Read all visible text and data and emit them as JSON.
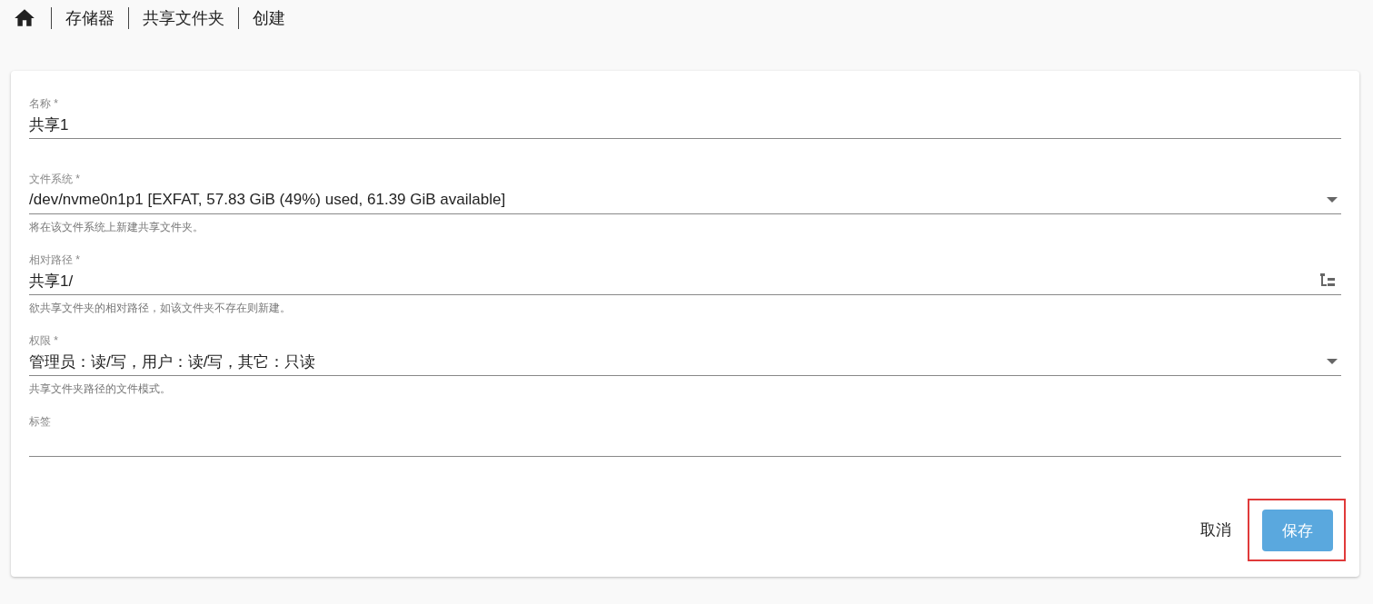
{
  "breadcrumb": [
    {
      "label": "存储器"
    },
    {
      "label": "共享文件夹"
    },
    {
      "label": "创建"
    }
  ],
  "fields": [
    {
      "kind": "text",
      "label": "名称 *",
      "value": "共享1"
    },
    {
      "kind": "select",
      "label": "文件系统 *",
      "value": "/dev/nvme0n1p1 [EXFAT, 57.83 GiB (49%) used, 61.39 GiB available]",
      "hint": "将在该文件系统上新建共享文件夹。"
    },
    {
      "kind": "folder",
      "label": "相对路径 *",
      "value": "共享1/",
      "hint": "欲共享文件夹的相对路径，如该文件夹不存在则新建。"
    },
    {
      "kind": "select",
      "label": "权限 *",
      "value": "管理员：读/写，用户：读/写，其它：只读",
      "hint": "共享文件夹路径的文件模式。"
    },
    {
      "kind": "text",
      "label": "标签"
    }
  ],
  "buttons": [
    {
      "kind": "text",
      "label": "取消",
      "highlighted": false
    },
    {
      "kind": "primary",
      "label": "保存",
      "highlighted": true
    }
  ]
}
